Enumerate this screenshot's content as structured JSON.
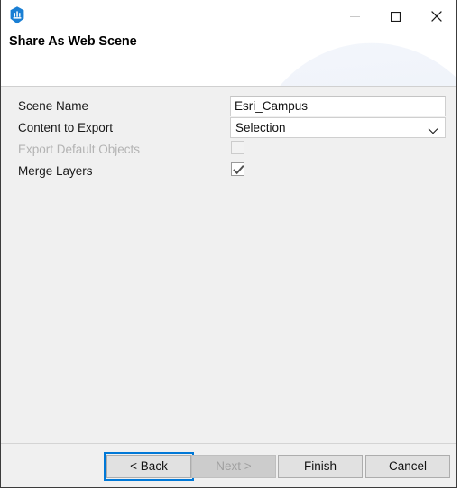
{
  "window": {
    "app_icon": "arcgis-pro-icon",
    "controls": {
      "minimize": "minimize-icon",
      "maximize": "maximize-icon",
      "close": "close-icon"
    }
  },
  "header": {
    "title": "Share As Web Scene"
  },
  "form": {
    "rows": [
      {
        "label": "Scene Name",
        "type": "text",
        "value": "Esri_Campus",
        "placeholder": "",
        "disabled": false
      },
      {
        "label": "Content to Export",
        "type": "combobox",
        "value": "Selection",
        "disabled": false
      },
      {
        "label": "Export Default Objects",
        "type": "checkbox",
        "checked": false,
        "disabled": true
      },
      {
        "label": "Merge Layers",
        "type": "checkbox",
        "checked": true,
        "disabled": false
      }
    ]
  },
  "footer": {
    "buttons": [
      {
        "label": "< Back",
        "state": "focused"
      },
      {
        "label": "Next >",
        "state": "disabled"
      },
      {
        "label": "Finish",
        "state": "normal"
      },
      {
        "label": "Cancel",
        "state": "normal"
      }
    ]
  },
  "colors": {
    "accent": "#0078d7",
    "body_bg": "#f0f0f0",
    "header_bg": "#ffffff",
    "disabled_text": "#b3b3b3"
  }
}
